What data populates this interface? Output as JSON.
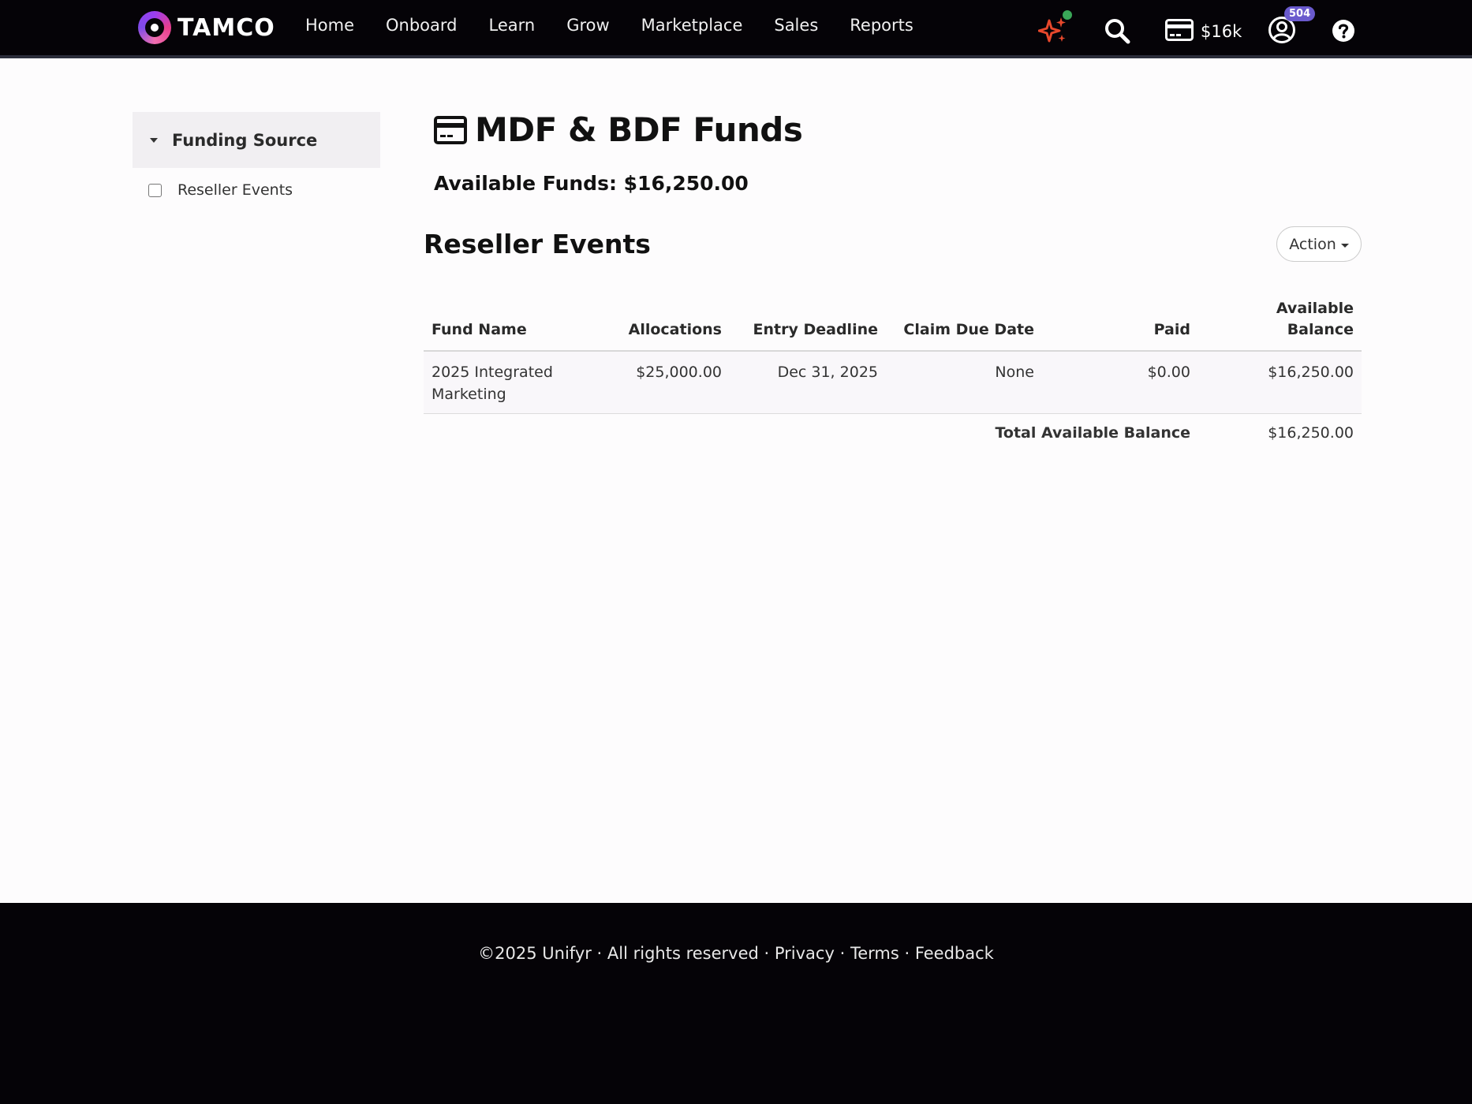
{
  "nav": {
    "brand": "TAMCO",
    "links": [
      "Home",
      "Onboard",
      "Learn",
      "Grow",
      "Marketplace",
      "Sales",
      "Reports"
    ],
    "funds_short": "$16k",
    "notification_count": "504"
  },
  "sidebar": {
    "heading": "Funding Source",
    "items": [
      {
        "label": "Reseller Events",
        "checked": false
      }
    ]
  },
  "main": {
    "title": "MDF & BDF Funds",
    "available_funds": "Available Funds: $16,250.00",
    "section_title": "Reseller Events",
    "action_label": "Action",
    "table": {
      "headers": [
        "Fund Name",
        "Allocations",
        "Entry Deadline",
        "Claim Due Date",
        "Paid",
        "Available Balance"
      ],
      "rows": [
        [
          "2025 Integrated Marketing",
          "$25,000.00",
          "Dec 31, 2025",
          "None",
          "$0.00",
          "$16,250.00"
        ]
      ],
      "total_label": "Total Available Balance",
      "total_value": "$16,250.00"
    }
  },
  "footer": {
    "copyright": "©2025  Unifyr · All rights reserved · ",
    "privacy": "Privacy",
    "sep1": " · ",
    "terms": "Terms",
    "sep2": " · ",
    "feedback": "Feedback"
  },
  "colors": {
    "nav_bg": "#050307",
    "badge": "#6a5acd",
    "sparkle": "#e8482c",
    "online_dot": "#3aa657"
  }
}
